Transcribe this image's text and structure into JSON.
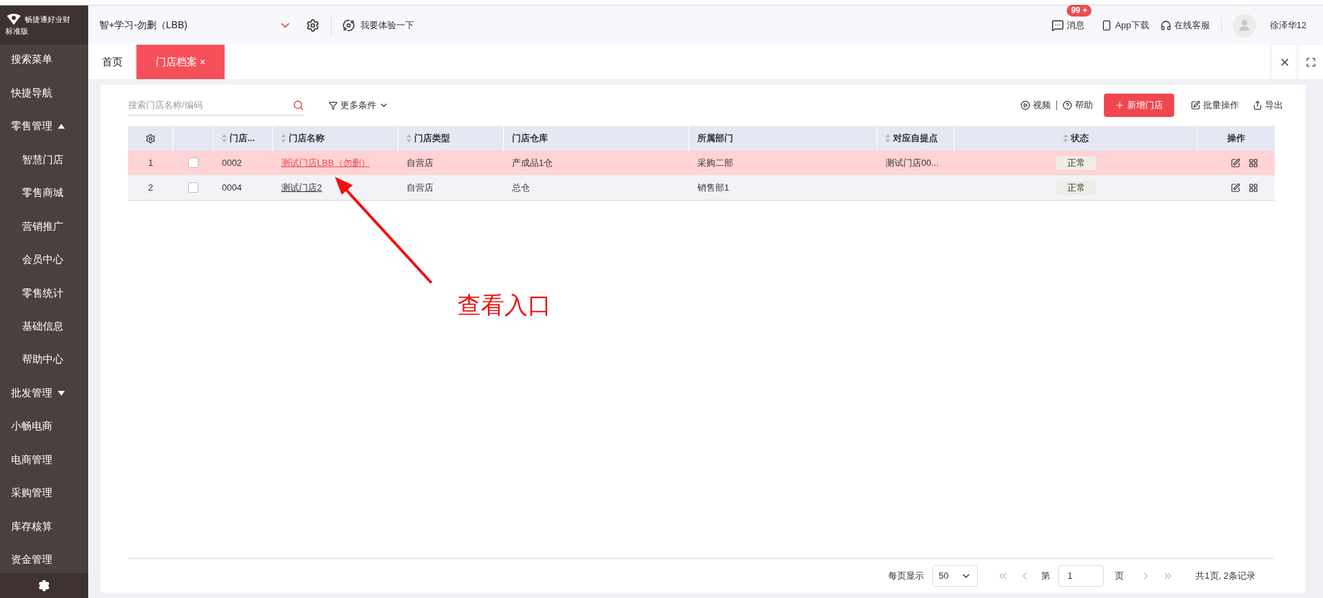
{
  "logo": {
    "brand": "畅捷通好业财",
    "edition": "标准版"
  },
  "header": {
    "account": "智+学习-勿删（LBB)",
    "try_link": "我要体验一下",
    "messages": {
      "label": "消息",
      "badge": "99 +"
    },
    "app_download": "App下载",
    "support": "在线客服",
    "user": "徐泽华12"
  },
  "sidebar": {
    "items": [
      {
        "label": "搜索菜单",
        "kind": "top"
      },
      {
        "label": "快捷导航",
        "kind": "top"
      },
      {
        "label": "零售管理",
        "kind": "group",
        "expanded": true,
        "children": [
          {
            "label": "智慧门店"
          },
          {
            "label": "零售商城"
          },
          {
            "label": "营销推广"
          },
          {
            "label": "会员中心"
          },
          {
            "label": "零售统计"
          },
          {
            "label": "基础信息"
          },
          {
            "label": "帮助中心"
          }
        ]
      },
      {
        "label": "批发管理",
        "kind": "group",
        "expanded": false
      },
      {
        "label": "小畅电商",
        "kind": "top"
      },
      {
        "label": "电商管理",
        "kind": "top"
      },
      {
        "label": "采购管理",
        "kind": "top"
      },
      {
        "label": "库存核算",
        "kind": "top"
      },
      {
        "label": "资金管理",
        "kind": "top"
      }
    ]
  },
  "tabs": [
    {
      "label": "首页",
      "selected": false,
      "closable": false
    },
    {
      "label": "门店档案",
      "selected": true,
      "closable": true,
      "close": "×"
    }
  ],
  "toolbar": {
    "search": {
      "placeholder": "搜索门店名称/编码"
    },
    "more_filters": "更多条件",
    "video": "视频",
    "help": "帮助",
    "add": "新增门店",
    "batch": "批量操作",
    "export": "导出"
  },
  "table": {
    "columns": [
      {
        "sortable": false
      },
      {
        "sortable": false
      },
      {
        "label": "门店...",
        "sortable": true
      },
      {
        "label": "门店名称",
        "sortable": true
      },
      {
        "label": "门店类型",
        "sortable": true
      },
      {
        "label": "门店仓库",
        "sortable": false
      },
      {
        "label": "所属部门",
        "sortable": false
      },
      {
        "label": "对应自提点",
        "sortable": true
      },
      {
        "label": "状态",
        "sortable": true
      },
      {
        "label": "操作",
        "sortable": false
      }
    ],
    "rows": [
      {
        "index": "1",
        "checked": false,
        "selected": true,
        "code": "0002",
        "name": "测试门店LBB（勿删）",
        "type": "自营店",
        "warehouse": "产成品1仓",
        "department": "采购二部",
        "pickup": "测试门店00...",
        "status": "正常"
      },
      {
        "index": "2",
        "checked": false,
        "selected": false,
        "code": "0004",
        "name": "测试门店2",
        "type": "自营店",
        "warehouse": "总仓",
        "department": "销售部1",
        "status": "正常"
      }
    ]
  },
  "annotation": {
    "text": "查看入口"
  },
  "pagination": {
    "page_size_label": "每页显示",
    "page_size": "50",
    "page_prefix": "第",
    "page": "1",
    "page_suffix": "页",
    "summary": "共1页, 2条记录"
  }
}
